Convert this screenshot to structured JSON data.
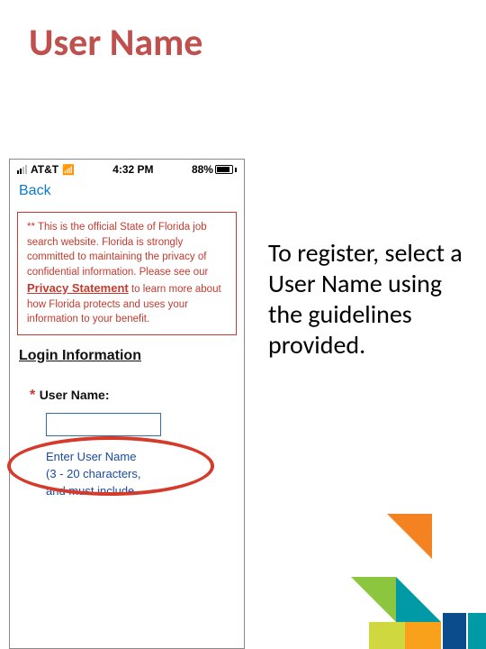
{
  "title": "User Name",
  "instruction": "To register, select a User Name using the guidelines provided.",
  "phone": {
    "status": {
      "carrier": "AT&T",
      "time": "4:32 PM",
      "battery_pct": "88%"
    },
    "nav": {
      "back": "Back"
    },
    "notice": {
      "line1": "** This is the official State of Florida job search website. Florida is strongly committed to maintaining the privacy of confidential information. Please see our ",
      "privacy": "Privacy Statement",
      "line2": " to learn more about how Florida protects and uses your information to your benefit."
    },
    "section": "Login Information",
    "field": {
      "asterisk": "*",
      "label": "User Name:",
      "hint": "Enter User Name (3 - 20 characters, and must include"
    }
  },
  "colors": {
    "accent_red": "#c0504d",
    "alert_red": "#c43a2f",
    "link_blue": "#0b79d0",
    "hint_blue": "#1b4aa0",
    "input_border": "#2f6ea7"
  }
}
